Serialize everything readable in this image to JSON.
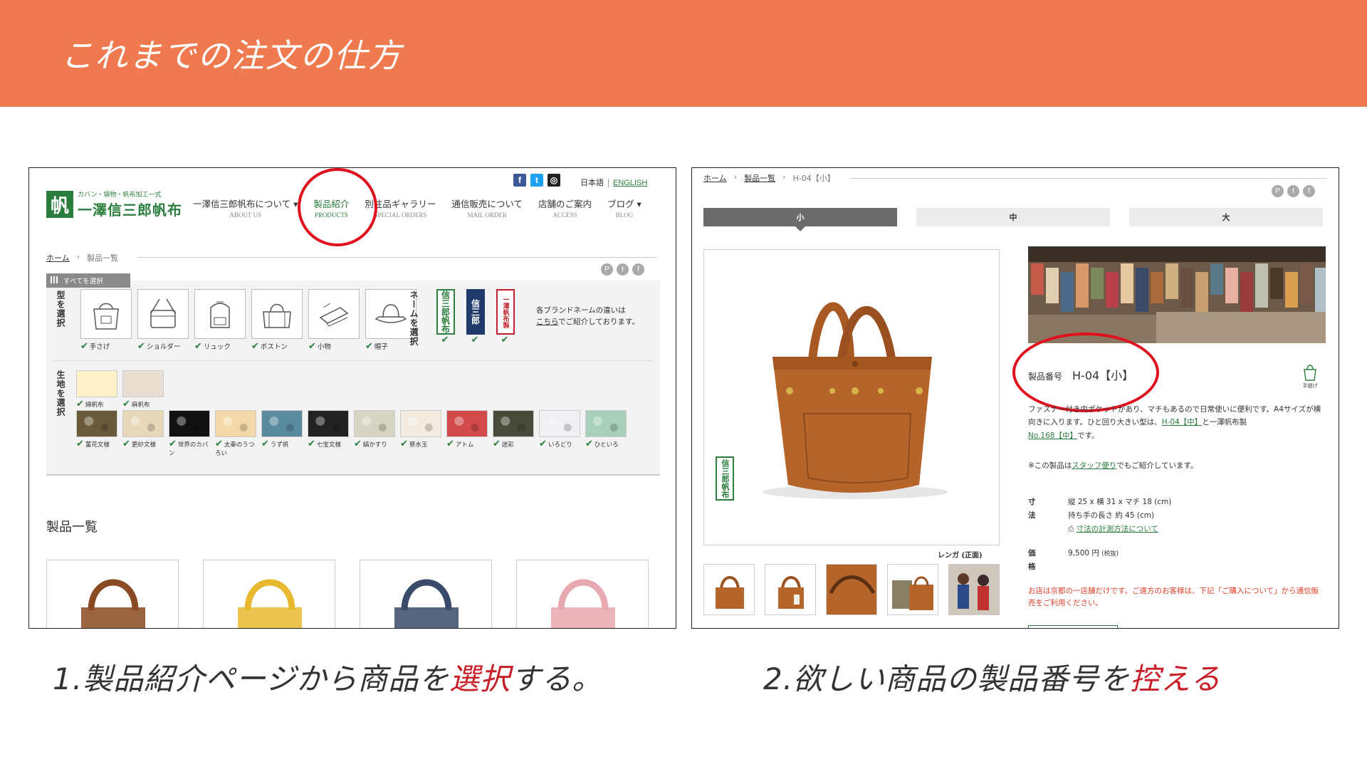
{
  "slide": {
    "title": "これまでの注文の仕方",
    "caption1": {
      "pre": "1.製品紹介ページから商品を",
      "highlight": "選択",
      "post": "する。"
    },
    "caption2": {
      "pre": "2.欲しい商品の製品番号を",
      "highlight": "控える"
    },
    "accent_color": "#f07a4f",
    "highlight_color": "#c81e28"
  },
  "panel1": {
    "social": [
      "f",
      "t",
      "◎"
    ],
    "lang": {
      "jp": "日本語",
      "en": "ENGLISH"
    },
    "logo": {
      "mark": "帆",
      "sub": "カバン・袋物・帆布加工一式",
      "name": "一澤信三郎帆布"
    },
    "nav": [
      {
        "jp": "一澤信三郎帆布について ▾",
        "en": "ABOUT US"
      },
      {
        "jp": "製品紹介",
        "en": "PRODUCTS"
      },
      {
        "jp": "別注品ギャラリー",
        "en": "SPECIAL ORDERS"
      },
      {
        "jp": "通信販売について",
        "en": "MAIL ORDER"
      },
      {
        "jp": "店舗のご案内",
        "en": "ACCESS"
      },
      {
        "jp": "ブログ ▾",
        "en": "BLOG"
      }
    ],
    "breadcrumb": {
      "home": "ホーム",
      "sep": "›",
      "current": "製品一覧"
    },
    "select_all": "すべてを選択",
    "type_label": "型を選択",
    "types": [
      "手さげ",
      "ショルダー",
      "リュック",
      "ボストン",
      "小物",
      "帽子"
    ],
    "brand_label": "ネームを選択",
    "brands": [
      "信三郎帆布",
      "信三郎",
      "一澤帆布製"
    ],
    "brand_note": {
      "line1": "各ブランドネームの違いは",
      "link": "こちら",
      "line2": "でご紹介しております。"
    },
    "fabric_label": "生地を選択",
    "fabrics_plain": [
      "綿帆布",
      "麻帆布"
    ],
    "fabrics_pattern": [
      {
        "name": "菫花文様",
        "color": "#6b5a3a"
      },
      {
        "name": "更紗文様",
        "color": "#e8d8b8"
      },
      {
        "name": "世界のカバン",
        "color": "#111111"
      },
      {
        "name": "太秦のうつろい",
        "color": "#f4d9a8"
      },
      {
        "name": "うず帆",
        "color": "#5a8aa0"
      },
      {
        "name": "七宝文様",
        "color": "#222222"
      },
      {
        "name": "縞かすり",
        "color": "#d8d4c4"
      },
      {
        "name": "祭水玉",
        "color": "#f2ece0"
      },
      {
        "name": "アトム",
        "color": "#d24a4a"
      },
      {
        "name": "迷彩",
        "color": "#4a4a3a"
      },
      {
        "name": "いろどり",
        "color": "#eef0f4"
      },
      {
        "name": "ひといろ",
        "color": "#a8d0b8"
      }
    ],
    "section_title": "製品一覧",
    "thumb_colors": [
      "#8a4a22",
      "#e8b830",
      "#3a4a6a",
      "#e8a8b0"
    ]
  },
  "panel2": {
    "breadcrumb": {
      "home": "ホーム",
      "list": "製品一覧",
      "current": "H-04【小】"
    },
    "size_tabs": [
      "小",
      "中",
      "大"
    ],
    "color_caption": "レンガ (正面)",
    "product_number_label": "製品番号",
    "product_number": "H-04【小】",
    "tote_caption": "手提げ",
    "desc1": "ファスナー付き内ポケットがあり、マチもあるので日常使いに便利です。A4サイズが横向きに入ります。ひと回り大きい型は、",
    "desc_link1": "H-04【中】",
    "desc2": "と一澤帆布製",
    "desc_link2": "No.168【中】",
    "desc3": "です。",
    "staff_note": {
      "pre": "※この製品は",
      "link": "スタッフ便り",
      "post": "でもご紹介しています。"
    },
    "spec_size_label": "寸 法",
    "spec_size_1": "縦 25 x 横 31 x マチ 18 (cm)",
    "spec_size_2": "持ち手の長さ 約 45 (cm)",
    "spec_size_link": "寸法の計測方法について",
    "spec_price_label": "価 格",
    "spec_price": "9,500 円",
    "spec_price_tax": "(税抜)",
    "notice": "お店は京都の一店舗だけです。ご遠方のお客様は、下記「ご購入について」から通信販売をご利用ください。",
    "bag_color": "#b5652a"
  }
}
